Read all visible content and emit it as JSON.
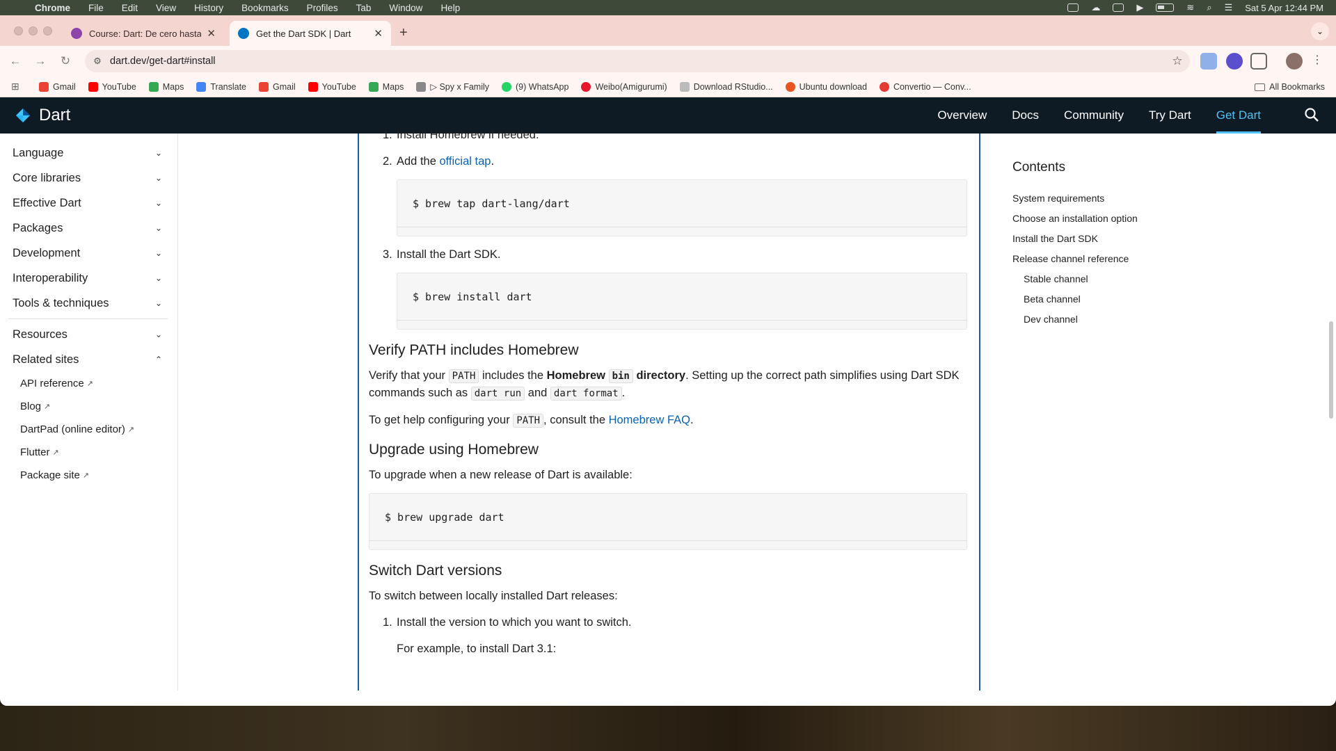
{
  "menubar": {
    "app": "Chrome",
    "items": [
      "File",
      "Edit",
      "View",
      "History",
      "Bookmarks",
      "Profiles",
      "Tab",
      "Window",
      "Help"
    ],
    "datetime": "Sat 5 Apr  12:44 PM"
  },
  "tabs": [
    {
      "title": "Course: Dart: De cero hasta l",
      "favicon_color": "#8e44ad"
    },
    {
      "title": "Get the Dart SDK | Dart",
      "favicon_color": "#0175c2"
    }
  ],
  "address": {
    "url": "dart.dev/get-dart#install"
  },
  "bookmarks": [
    {
      "label": "Gmail",
      "color": "#ea4335"
    },
    {
      "label": "YouTube",
      "color": "#ff0000"
    },
    {
      "label": "Maps",
      "color": "#34a853"
    },
    {
      "label": "Translate",
      "color": "#4285f4"
    },
    {
      "label": "Gmail",
      "color": "#ea4335"
    },
    {
      "label": "YouTube",
      "color": "#ff0000"
    },
    {
      "label": "Maps",
      "color": "#34a853"
    },
    {
      "label": "▷ Spy x Family",
      "color": "#888888"
    },
    {
      "label": "(9) WhatsApp",
      "color": "#25d366"
    },
    {
      "label": "Weibo(Amigurumi)",
      "color": "#e6162d"
    },
    {
      "label": "Download RStudio...",
      "color": "#bbbbbb"
    },
    {
      "label": "Ubuntu download",
      "color": "#e95420"
    },
    {
      "label": "Convertio — Conv...",
      "color": "#e53935"
    }
  ],
  "all_bookmarks": "All Bookmarks",
  "dart": {
    "logo": "Dart",
    "nav": [
      "Overview",
      "Docs",
      "Community",
      "Try Dart",
      "Get Dart"
    ],
    "active_nav": "Get Dart"
  },
  "sidebar": {
    "sections": [
      "Language",
      "Core libraries",
      "Effective Dart",
      "Packages",
      "Development",
      "Interoperability",
      "Tools & techniques"
    ],
    "resources": "Resources",
    "related": "Related sites",
    "related_links": [
      "API reference",
      "Blog",
      "DartPad (online editor)",
      "Flutter",
      "Package site"
    ]
  },
  "content": {
    "step1": "Install Homebrew if needed.",
    "step2_pre": "Add the ",
    "step2_link": "official tap",
    "step2_post": ".",
    "code1": "$ brew tap dart-lang/dart",
    "step3": "Install the Dart SDK.",
    "code2": "$ brew install dart",
    "h_verify": "Verify PATH includes Homebrew",
    "verify_p1": "Verify that your",
    "verify_path": "PATH",
    "verify_p2": "includes the",
    "verify_homebrew": "Homebrew",
    "verify_bin": "bin",
    "verify_dir": "directory",
    "verify_p3": ". Setting up the correct path simplifies using Dart SDK commands such as",
    "verify_run": "dart run",
    "verify_and": "and",
    "verify_format": "dart format",
    "help_p1": "To get help configuring your",
    "help_path": "PATH",
    "help_p2": ", consult the ",
    "help_link": "Homebrew FAQ",
    "h_upgrade": "Upgrade using Homebrew",
    "upgrade_p": "To upgrade when a new release of Dart is available:",
    "code3": "$ brew upgrade dart",
    "h_switch": "Switch Dart versions",
    "switch_p": "To switch between locally installed Dart releases:",
    "switch_step1": "Install the version to which you want to switch.",
    "switch_example": "For example, to install Dart 3.1:"
  },
  "toc": {
    "heading": "Contents",
    "items": [
      "System requirements",
      "Choose an installation option",
      "Install the Dart SDK",
      "Release channel reference"
    ],
    "subitems": [
      "Stable channel",
      "Beta channel",
      "Dev channel"
    ]
  }
}
